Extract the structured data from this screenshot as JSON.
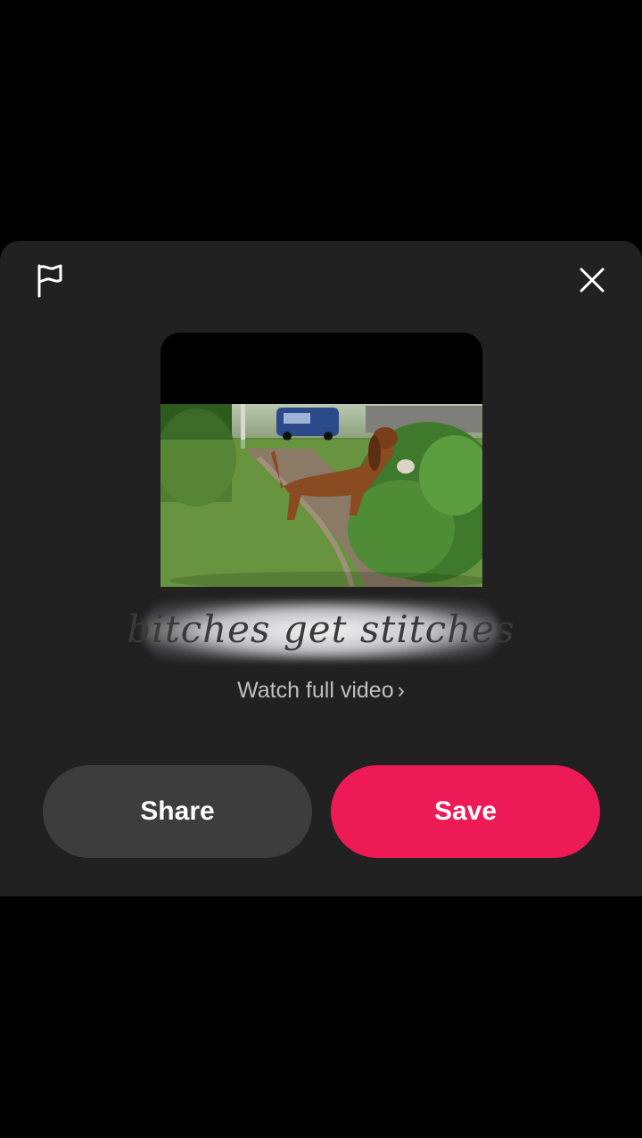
{
  "dialog": {
    "report_icon": "flag-icon",
    "close_icon": "close-icon",
    "caption": "bitches get stitches",
    "watch_link": "Watch full video",
    "watch_chevron": "›"
  },
  "actions": {
    "share_label": "Share",
    "save_label": "Save"
  },
  "colors": {
    "sheet_bg": "#212121",
    "share_bg": "#3d3d3d",
    "save_bg": "#ed1a55"
  }
}
